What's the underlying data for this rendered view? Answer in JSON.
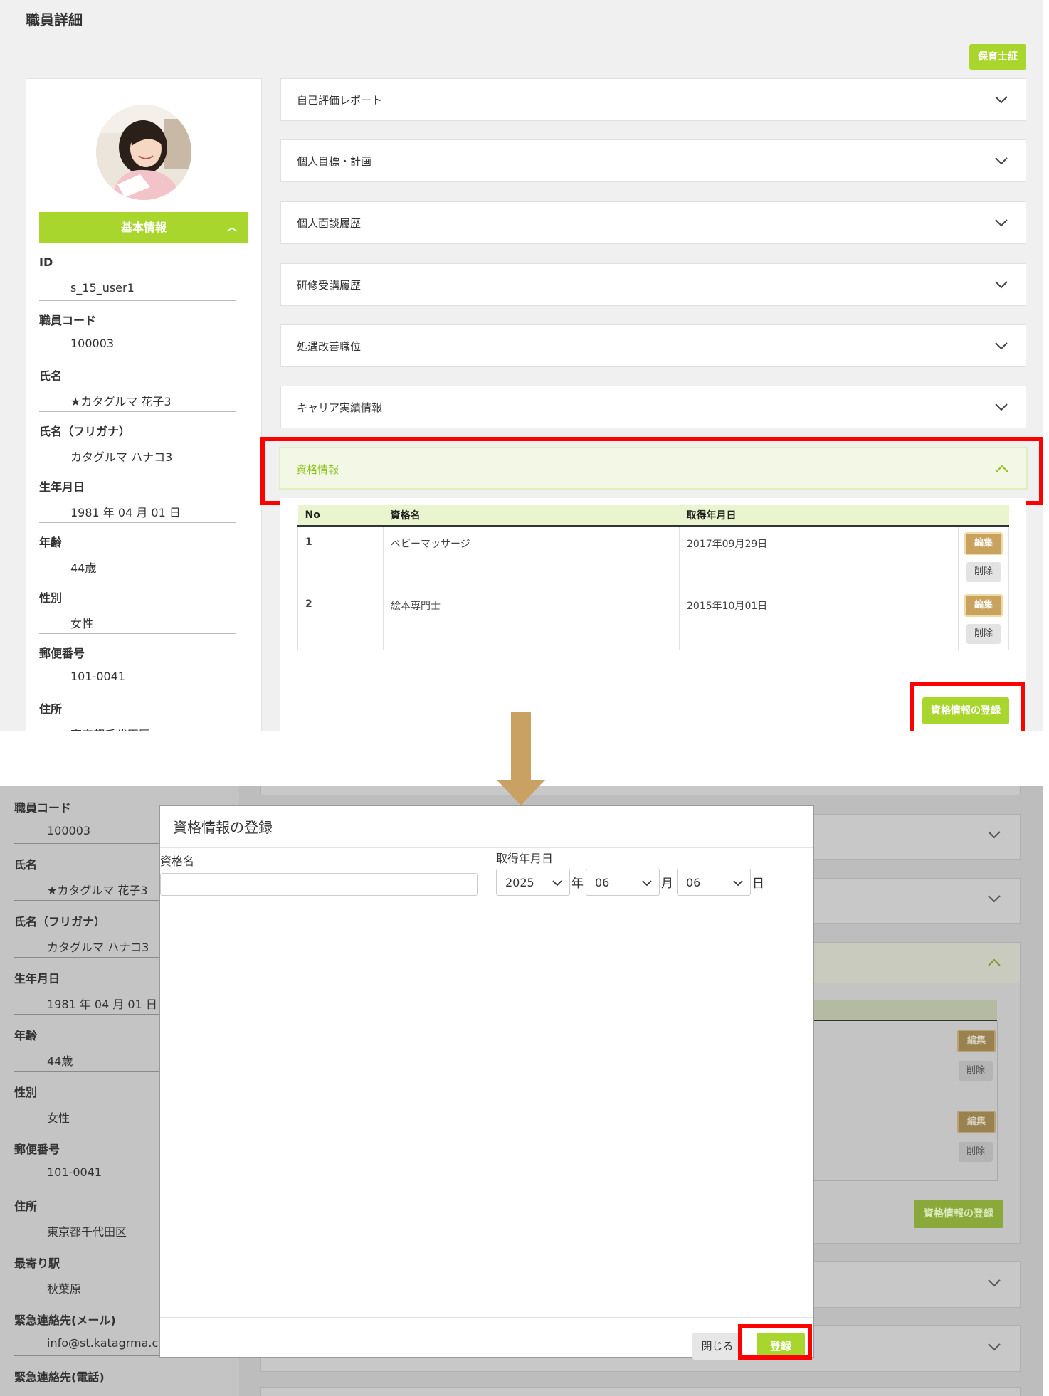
{
  "top": {
    "page_title": "職員詳細",
    "qual_button": "保育士証",
    "profile": {
      "section_title": "基本情報",
      "fields": [
        {
          "label": "ID",
          "value": "s_15_user1"
        },
        {
          "label": "職員コード",
          "value": "100003"
        },
        {
          "label": "氏名",
          "value": "★カタグルマ 花子3"
        },
        {
          "label": "氏名（フリガナ）",
          "value": "カタグルマ ハナコ3"
        },
        {
          "label": "生年月日",
          "value": "1981 年 04 月 01 日"
        },
        {
          "label": "年齢",
          "value": "44歳"
        },
        {
          "label": "性別",
          "value": "女性"
        },
        {
          "label": "郵便番号",
          "value": "101-0041"
        },
        {
          "label": "住所",
          "value": "東京都千代田区"
        }
      ]
    },
    "accordions": [
      "自己評価レポート",
      "個人目標・計画",
      "個人面談履歴",
      "研修受講履歴",
      "処遇改善職位",
      "キャリア実績情報",
      "資格情報"
    ],
    "qual_table": {
      "headers": [
        "No",
        "資格名",
        "取得年月日",
        ""
      ],
      "rows": [
        {
          "no": "1",
          "name": "ベビーマッサージ",
          "date": "2017年09月29日"
        },
        {
          "no": "2",
          "name": "絵本専門士",
          "date": "2015年10月01日"
        }
      ],
      "edit_label": "編集",
      "delete_label": "削除",
      "register_label": "資格情報の登録"
    }
  },
  "bottom": {
    "fields": [
      {
        "label": "職員コード",
        "value": "100003"
      },
      {
        "label": "氏名",
        "value": "★カタグルマ 花子3"
      },
      {
        "label": "氏名（フリガナ）",
        "value": "カタグルマ ハナコ3"
      },
      {
        "label": "生年月日",
        "value": "1981 年 04 月 01 日"
      },
      {
        "label": "年齢",
        "value": "44歳"
      },
      {
        "label": "性別",
        "value": "女性"
      },
      {
        "label": "郵便番号",
        "value": "101-0041"
      },
      {
        "label": "住所",
        "value": "東京都千代田区"
      },
      {
        "label": "最寄り駅",
        "value": "秋葉原"
      },
      {
        "label": "緊急連絡先(メール)",
        "value": "info@st.katagrma.co.jp"
      },
      {
        "label": "緊急連絡先(電話)",
        "value": ""
      }
    ],
    "edit_label": "編集",
    "delete_label": "削除",
    "register_label": "資格情報の登録",
    "modal": {
      "title": "資格情報の登録",
      "name_label": "資格名",
      "name_value": "",
      "date_label": "取得年月日",
      "year": "2025",
      "year_unit": "年",
      "month": "06",
      "month_unit": "月",
      "day": "06",
      "day_unit": "日",
      "close_label": "閉じる",
      "submit_label": "登録"
    }
  },
  "colors": {
    "accent_green": "#a8d62d",
    "highlight_red": "#ff0000",
    "edit_brown": "#c9a35d",
    "arrow": "#c8a163"
  }
}
